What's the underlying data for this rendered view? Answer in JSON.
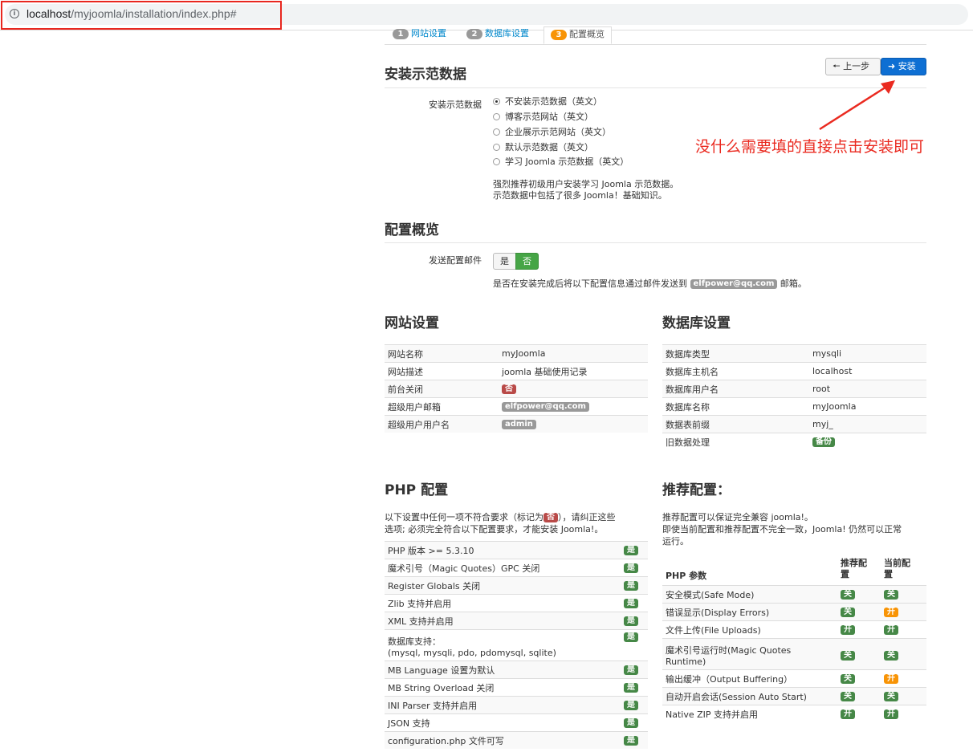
{
  "browser": {
    "url_host": "localhost",
    "url_path": "/myjoomla/installation/index.php#"
  },
  "tabs": [
    {
      "num": "1",
      "label": "网站设置"
    },
    {
      "num": "2",
      "label": "数据库设置"
    },
    {
      "num": "3",
      "label": "配置概览"
    }
  ],
  "sample_section": {
    "title": "安装示范数据",
    "field_label": "安装示范数据",
    "options": [
      "不安装示范数据（英文）",
      "博客示范网站（英文）",
      "企业展示示范网站（英文）",
      "默认示范数据（英文）",
      "学习 Joomla 示范数据（英文）"
    ],
    "note_line1": "强烈推荐初级用户安装学习 Joomla 示范数据。",
    "note_line2": "示范数据中包括了很多 Joomla！基础知识。"
  },
  "buttons": {
    "prev": "上一步",
    "install": "安装"
  },
  "annotation": "没什么需要填的直接点击安装即可",
  "overview_section": {
    "title": "配置概览",
    "email_label": "发送配置邮件",
    "yes": "是",
    "no": "否",
    "note_pre": "是否在安装完成后将以下配置信息通过邮件发送到",
    "email": "elfpower@qq.com",
    "note_post": "邮箱。"
  },
  "site_settings": {
    "title": "网站设置",
    "rows": [
      {
        "label": "网站名称",
        "value": "myJoomla"
      },
      {
        "label": "网站描述",
        "value": "joomla 基础使用记录"
      },
      {
        "label": "前台关闭",
        "value": "否"
      },
      {
        "label": "超级用户邮箱",
        "value": "elfpower@qq.com"
      },
      {
        "label": "超级用户用户名",
        "value": "admin"
      }
    ]
  },
  "db_settings": {
    "title": "数据库设置",
    "rows": [
      {
        "label": "数据库类型",
        "value": "mysqli"
      },
      {
        "label": "数据库主机名",
        "value": "localhost"
      },
      {
        "label": "数据库用户名",
        "value": "root"
      },
      {
        "label": "数据库名称",
        "value": "myJoomla"
      },
      {
        "label": "数据表前缀",
        "value": "myj_"
      },
      {
        "label": "旧数据处理",
        "value": "备份"
      }
    ]
  },
  "php_config": {
    "title": "PHP 配置",
    "desc_pre": "以下设置中任何一项不符合要求（标记为",
    "desc_badge": "否",
    "desc_post": "），请纠正这些",
    "desc_line2": "选项; 必须完全符合以下配置要求，才能安装 Joomla!。",
    "ok": "是",
    "rows": [
      "PHP 版本 >= 5.3.10",
      "魔术引号（Magic Quotes）GPC 关闭",
      "Register Globals 关闭",
      "Zlib 支持并启用",
      "XML 支持并启用",
      "数据库支持：",
      "MB Language 设置为默认",
      "MB String Overload 关闭",
      "INI Parser 支持并启用",
      "JSON 支持",
      "configuration.php 文件可写"
    ],
    "db_support_line2": "(mysql, mysqli, pdo, pdomysql, sqlite)"
  },
  "recommended": {
    "title": "推荐配置：",
    "desc_line1": "推荐配置可以保证完全兼容 joomla!。",
    "desc_line2": "即使当前配置和推荐配置不完全一致，Joomla! 仍然可以正常",
    "desc_line3": "运行。",
    "col_param": "PHP 参数",
    "col_rec_1": "推荐配",
    "col_rec_2": "置",
    "col_cur_1": "当前配",
    "col_cur_2": "置",
    "rows": [
      {
        "param": "安全模式(Safe Mode)",
        "rec": "关",
        "cur": "关",
        "cur_color": "#468847"
      },
      {
        "param": "错误显示(Display Errors)",
        "rec": "关",
        "cur": "开",
        "cur_color": "#f89406"
      },
      {
        "param": "文件上传(File Uploads)",
        "rec": "开",
        "cur": "开",
        "cur_color": "#468847"
      },
      {
        "param": "魔术引号运行时(Magic Quotes",
        "param2": "Runtime)",
        "rec": "关",
        "cur": "关",
        "cur_color": "#468847"
      },
      {
        "param": "输出缓冲（Output Buffering）",
        "rec": "关",
        "cur": "开",
        "cur_color": "#f89406"
      },
      {
        "param": "自动开启会话(Session Auto Start)",
        "rec": "关",
        "cur": "关",
        "cur_color": "#468847"
      },
      {
        "param": "Native ZIP 支持并启用",
        "rec": "开",
        "cur": "开",
        "cur_color": "#468847"
      }
    ]
  }
}
